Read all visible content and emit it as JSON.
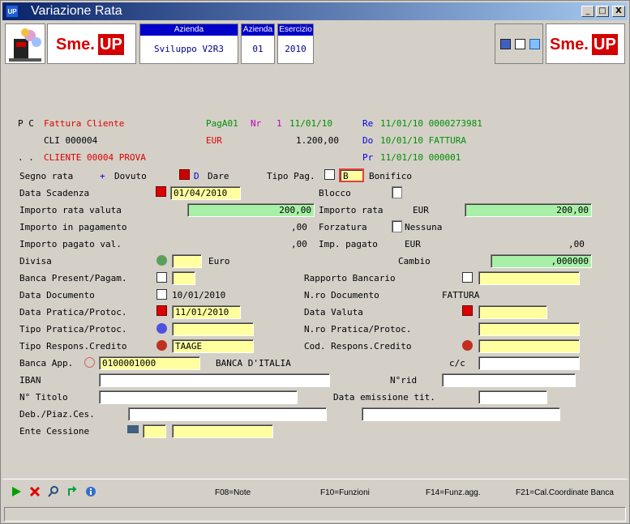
{
  "window": {
    "icon_label": "UP",
    "title": "Variazione Rata",
    "minimize": "_",
    "maximize": "□",
    "close": "X"
  },
  "header": {
    "azienda_caption": "Azienda",
    "azienda_value": "Sviluppo V2R3",
    "azienda2_caption": "Azienda",
    "azienda2_value": "01",
    "esercizio_caption": "Esercizio",
    "esercizio_value": "2010",
    "logo_sme": "Sme.",
    "logo_up": "UP"
  },
  "summary": {
    "line1_pc": "P C",
    "line1_doc": "Fattura Cliente",
    "line1_paga": "PagA01",
    "line1_nr_label": "Nr",
    "line1_nr_value": "1",
    "line1_date": "11/01/10",
    "line1_re_label": "Re",
    "line1_re_value": "11/01/10 0000273981",
    "line2_cli": "CLI 000004",
    "line2_currency": "EUR",
    "line2_amount": "1.200,00",
    "line2_do_label": "Do",
    "line2_do_value": "10/01/10 FATTURA",
    "line3_dots": ". .",
    "line3_cliente": "CLIENTE 00004 PROVA",
    "line3_pr_label": "Pr",
    "line3_pr_value": "11/01/10 000001"
  },
  "form": {
    "segno_rata_label": "Segno rata",
    "segno_rata_sign": "+",
    "segno_rata_value": "Dovuto",
    "dare_code": "D",
    "dare_label": "Dare",
    "tipo_pag_label": "Tipo Pag.",
    "tipo_pag_value": "B",
    "tipo_pag_desc": "Bonifico",
    "data_scadenza_label": "Data Scadenza",
    "data_scadenza_value": "01/04/2010",
    "blocco_label": "Blocco",
    "importo_rata_valuta_label": "Importo rata valuta",
    "importo_rata_valuta_value": "200,00",
    "importo_rata_label": "Importo rata",
    "importo_rata_currency": "EUR",
    "importo_rata_value": "200,00",
    "importo_pagamento_label": "Importo in pagamento",
    "importo_pagamento_value": ",00",
    "forzatura_label": "Forzatura",
    "forzatura_value": "Nessuna",
    "importo_pagato_label": "Importo pagato val.",
    "importo_pagato_value": ",00",
    "imp_pagato_label": "Imp. pagato",
    "imp_pagato_currency": "EUR",
    "imp_pagato_value": ",00",
    "divisa_label": "Divisa",
    "divisa_value": "",
    "divisa_desc": "Euro",
    "cambio_label": "Cambio",
    "cambio_value": ",000000",
    "banca_present_label": "Banca Present/Pagam.",
    "banca_present_value": "",
    "rapporto_bancario_label": "Rapporto Bancario",
    "rapporto_bancario_value": "",
    "data_documento_label": "Data Documento",
    "data_documento_value": "10/01/2010",
    "nro_documento_label": "N.ro Documento",
    "nro_documento_value": "FATTURA",
    "data_pratica_label": "Data Pratica/Protoc.",
    "data_pratica_value": "11/01/2010",
    "data_valuta_label": "Data Valuta",
    "data_valuta_value": "",
    "tipo_pratica_label": "Tipo Pratica/Protoc.",
    "tipo_pratica_value": "",
    "nro_pratica_label": "N.ro Pratica/Protoc.",
    "nro_pratica_value": "",
    "tipo_respons_label": "Tipo Respons.Credito",
    "tipo_respons_value": "TAAGE",
    "cod_respons_label": "Cod. Respons.Credito",
    "cod_respons_value": "",
    "banca_app_label": "Banca App.",
    "banca_app_value": "0100001000",
    "banca_app_desc": "BANCA D'ITALIA",
    "cc_label": "c/c",
    "cc_value": "",
    "iban_label": "IBAN",
    "iban_value": "",
    "nrid_label": "N°rid",
    "nrid_value": "",
    "ntitolo_label": "N° Titolo",
    "ntitolo_value": "",
    "data_emissione_label": "Data emissione tit.",
    "data_emissione_value": "",
    "deb_piaz_label": "Deb./Piaz.Ces.",
    "deb_piaz_value1": "",
    "deb_piaz_value2": "",
    "ente_cessione_label": "Ente Cessione",
    "ente_cessione_value1": "",
    "ente_cessione_value2": ""
  },
  "statusbar": {
    "f08": "F08=Note",
    "f10": "F10=Funzioni",
    "f14": "F14=Funz.agg.",
    "f21": "F21=Cal.Coordinate Banca"
  },
  "colors": {
    "title_gradient_start": "#0a246a",
    "title_gradient_end": "#a6caf0",
    "header_caption_bg": "#0000c8",
    "field_yellow": "#ffffa0",
    "field_green": "#a8f0a8",
    "label_red": "#e00000",
    "label_green": "#009000",
    "label_blue": "#0000e0",
    "logo_red": "#d40000"
  }
}
